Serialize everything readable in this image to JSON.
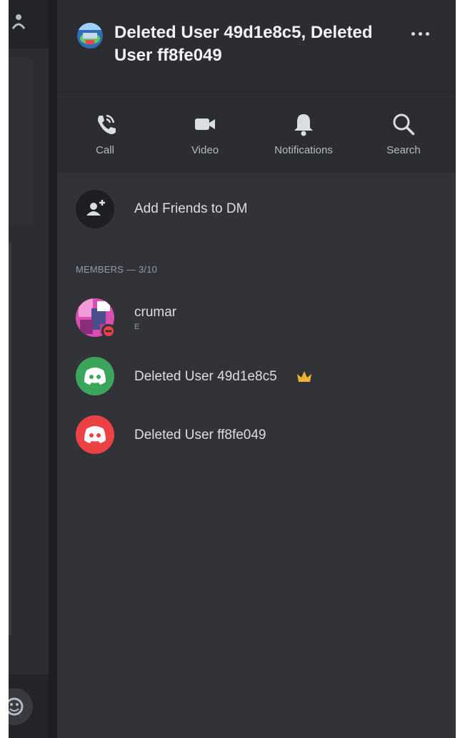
{
  "header": {
    "title": "Deleted User 49d1e8c5, Deleted User ff8fe049"
  },
  "actions": [
    {
      "label": "Call",
      "icon": "phone-icon"
    },
    {
      "label": "Video",
      "icon": "video-icon"
    },
    {
      "label": "Notifications",
      "icon": "bell-icon"
    },
    {
      "label": "Search",
      "icon": "search-icon"
    }
  ],
  "add_friends": {
    "label": "Add Friends to DM",
    "icon": "add-user-icon"
  },
  "members_header": "MEMBERS — 3/10",
  "members": [
    {
      "name": "crumar",
      "status_text": "E",
      "presence": "do-not-disturb",
      "owner": false
    },
    {
      "name": "Deleted User 49d1e8c5",
      "avatar_color": "#3ba55c",
      "owner": true
    },
    {
      "name": "Deleted User ff8fe049",
      "avatar_color": "#ed4245",
      "owner": false
    }
  ],
  "colors": {
    "background": "#313338",
    "header": "#2b2d31",
    "text": "#dbdee1",
    "muted": "#949ba4",
    "crown": "#f0b232",
    "dnd": "#ed4245"
  }
}
